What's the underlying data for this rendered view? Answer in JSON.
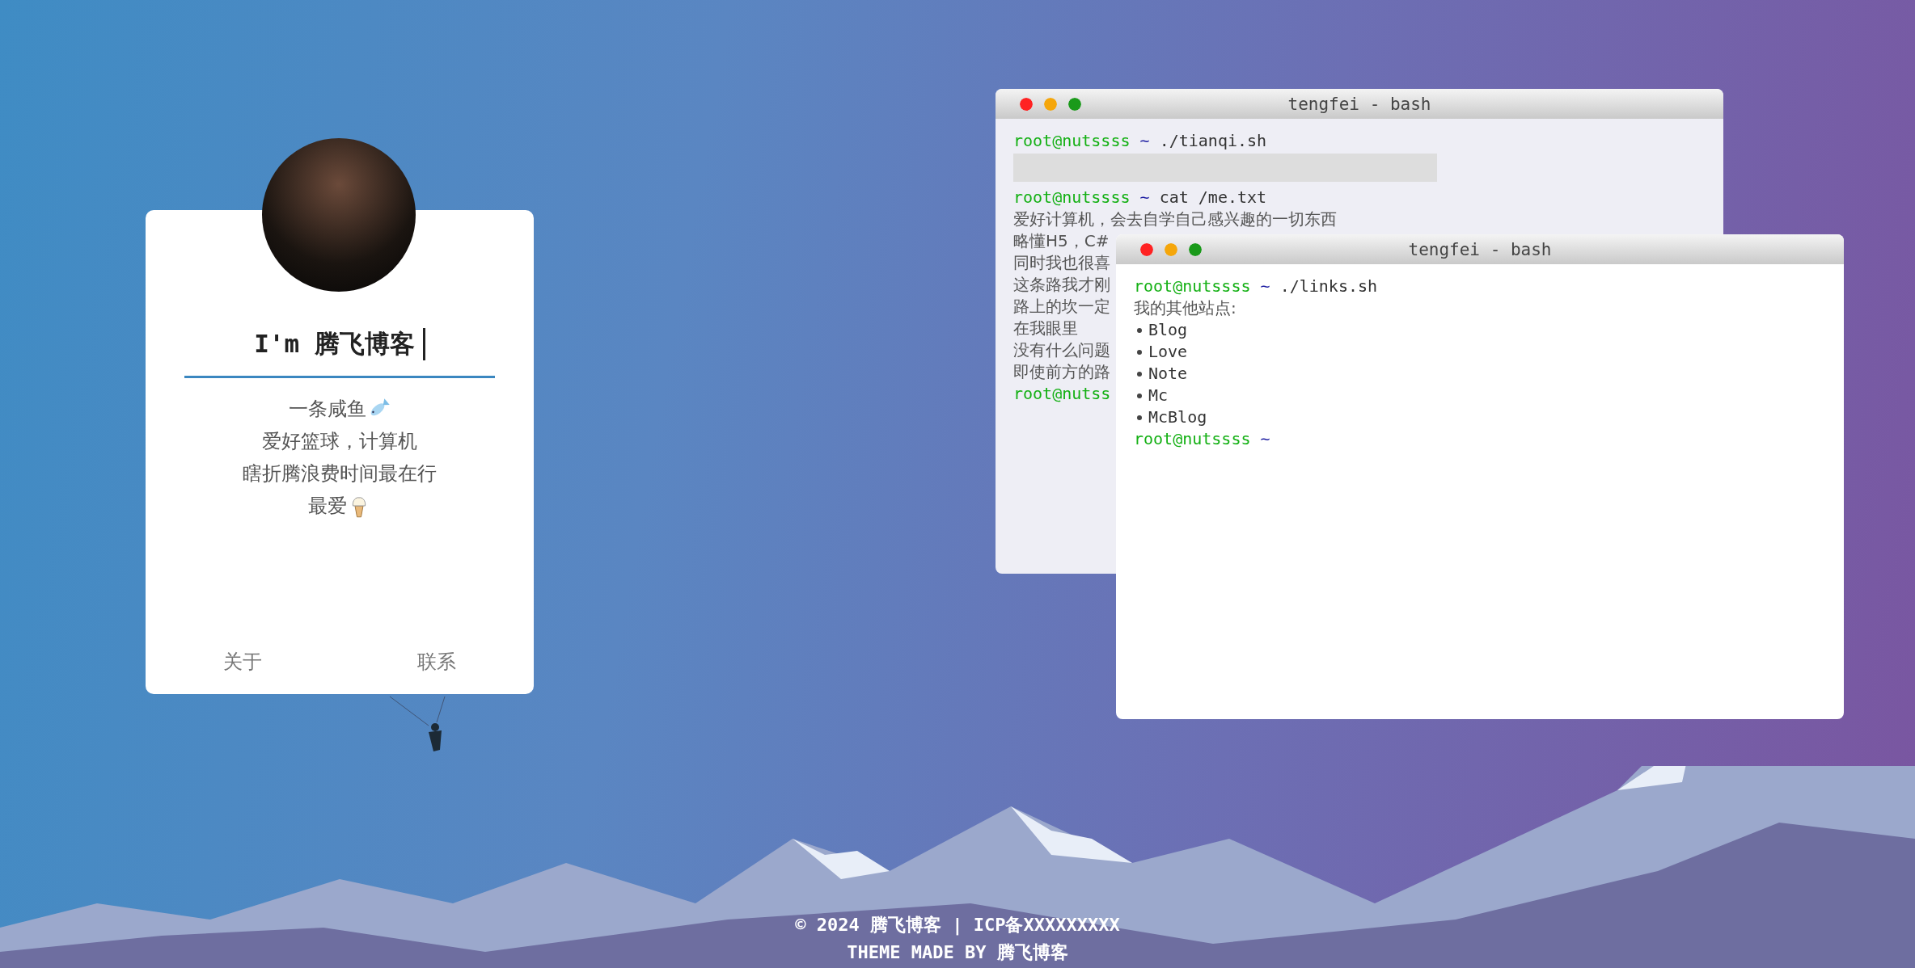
{
  "profile_card": {
    "title": "I'm 腾飞博客",
    "lines": [
      {
        "kind": "fish",
        "text": "一条咸鱼"
      },
      {
        "kind": "plain",
        "text": "爱好篮球，计算机"
      },
      {
        "kind": "plain",
        "text": "瞎折腾浪费时间最在行"
      },
      {
        "kind": "icecream",
        "text": "最爱"
      }
    ],
    "links": [
      "关于",
      "联系"
    ]
  },
  "terminals": [
    {
      "title": "tengfei - bash",
      "lines": [
        {
          "kind": "prompt",
          "user": "root@nutssss",
          "tilde": "~",
          "command": "./tianqi.sh"
        },
        {
          "kind": "block"
        },
        {
          "kind": "prompt",
          "user": "root@nutssss",
          "tilde": "~",
          "command": "cat /me.txt"
        },
        {
          "kind": "text",
          "text": "爱好计算机，会去自学自己感兴趣的一切东西"
        },
        {
          "kind": "text",
          "text": "略懂H5，C#"
        },
        {
          "kind": "text",
          "text": "同时我也很喜"
        },
        {
          "kind": "text",
          "text": "这条路我才刚"
        },
        {
          "kind": "text",
          "text": "路上的坎一定"
        },
        {
          "kind": "text",
          "text": "在我眼里"
        },
        {
          "kind": "text",
          "text": "没有什么问题"
        },
        {
          "kind": "text",
          "text": "即使前方的路"
        },
        {
          "kind": "prompt",
          "user": "root@nutss"
        }
      ]
    },
    {
      "title": "tengfei - bash",
      "lines": [
        {
          "kind": "prompt",
          "user": "root@nutssss",
          "tilde": "~",
          "command": "./links.sh"
        },
        {
          "kind": "text",
          "text": "我的其他站点:"
        },
        {
          "kind": "list",
          "items": [
            "Blog",
            "Love",
            "Note",
            "Mc",
            "McBlog"
          ]
        },
        {
          "kind": "prompt",
          "user": "root@nutssss",
          "tilde": "~"
        }
      ]
    }
  ],
  "footer": {
    "lines": [
      "© 2024 腾飞博客 | ICP备XXXXXXXXX",
      "THEME MADE BY 腾飞博客"
    ]
  }
}
